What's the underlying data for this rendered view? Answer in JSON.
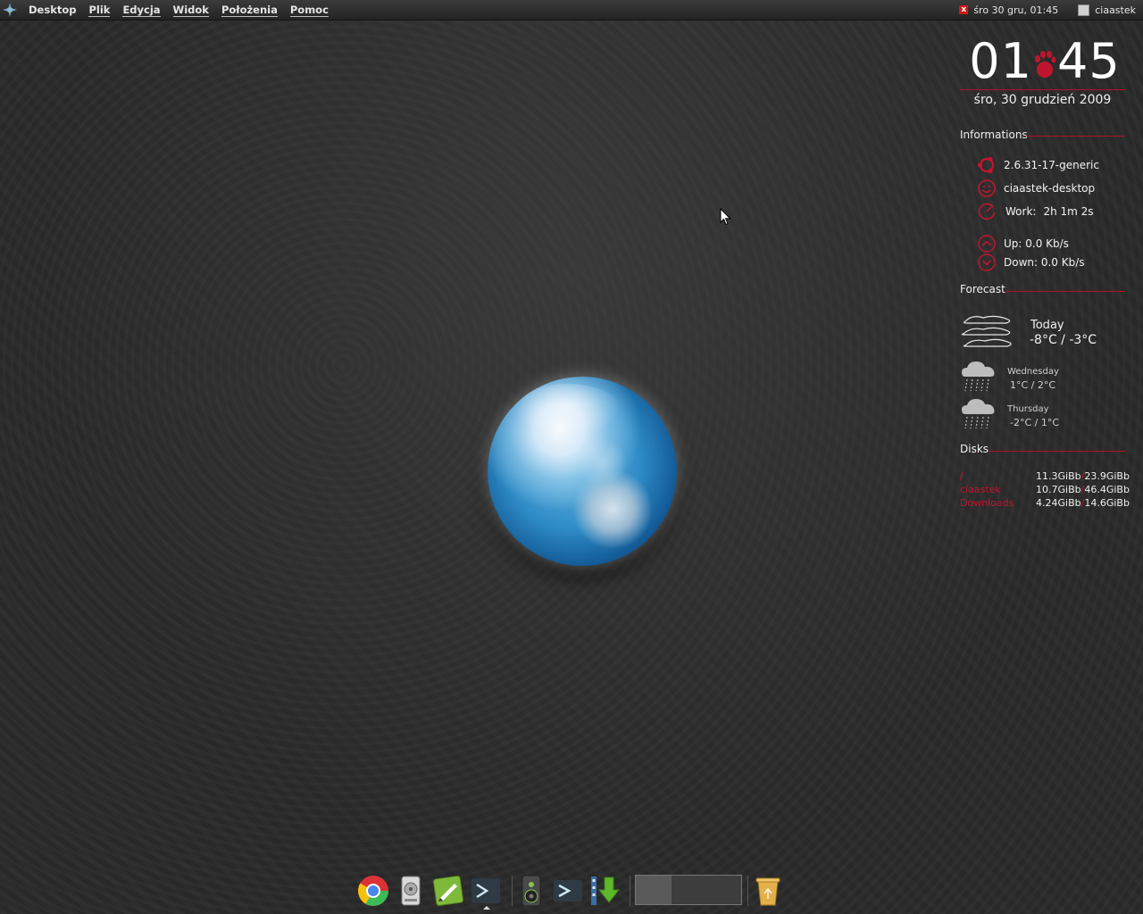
{
  "top_panel": {
    "menu": [
      "Desktop",
      "Plik",
      "Edycja",
      "Widok",
      "Położenia",
      "Pomoc"
    ],
    "datetime": "śro 30 gru, 01:45",
    "user": "ciaastek",
    "notify_icon": "close-x-icon"
  },
  "conky": {
    "clock_hours": "01",
    "clock_minutes": "45",
    "date": "śro, 30 grudzień 2009",
    "informations_title": "Informations",
    "kernel": "2.6.31-17-generic",
    "hostname": "ciaastek-desktop",
    "work_label": "Work:",
    "work_value": "2h 1m 2s",
    "up": "Up: 0.0 Kb/s",
    "down": "Down: 0.0 Kb/s",
    "forecast_title": "Forecast",
    "forecast": [
      {
        "day": "Today",
        "temp": "-8°C / -3°C",
        "icon": "cloudy-icon"
      },
      {
        "day": "Wednesday",
        "temp": "1°C / 2°C",
        "icon": "rain-icon"
      },
      {
        "day": "Thursday",
        "temp": "-2°C / 1°C",
        "icon": "rain-icon"
      }
    ],
    "disks_title": "Disks",
    "disks": [
      {
        "name": "/",
        "used": "11.3GiBb",
        "total": "23.9GiBb"
      },
      {
        "name": "ciaastek",
        "used": "10.7GiBb",
        "total": "46.4GiBb"
      },
      {
        "name": "Downloads",
        "used": "4.24GiBb",
        "total": "14.6GiBb"
      }
    ],
    "accent_color": "#b0142a"
  },
  "dock": {
    "items": [
      "chrome-icon",
      "disk-utility-icon",
      "text-editor-icon",
      "terminal-icon",
      "speaker-icon",
      "terminal-icon",
      "download-icon",
      "trash-icon"
    ]
  }
}
